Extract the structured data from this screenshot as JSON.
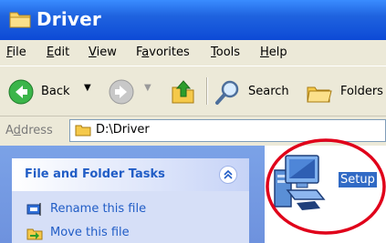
{
  "window": {
    "title": "Driver"
  },
  "menu": [
    {
      "underline": "F",
      "rest": "ile"
    },
    {
      "underline": "E",
      "rest": "dit"
    },
    {
      "underline": "V",
      "rest": "iew"
    },
    {
      "pre": "F",
      "underline": "a",
      "rest": "vorites"
    },
    {
      "underline": "T",
      "rest": "ools"
    },
    {
      "underline": "H",
      "rest": "elp"
    }
  ],
  "toolbar": {
    "back_label": "Back",
    "search_label": "Search",
    "folders_label": "Folders"
  },
  "address": {
    "label_pre": "A",
    "label_underline": "d",
    "label_rest": "dress",
    "path": "D:\\Driver"
  },
  "tasks": {
    "title": "File and Folder Tasks",
    "items": [
      "Rename this file",
      "Move this file"
    ]
  },
  "files": [
    {
      "name": "Setup",
      "icon": "setup-computer-icon",
      "selected": true
    }
  ],
  "colors": {
    "titlebar": "#0d4ad6",
    "taskpane": "#6e92de",
    "selection": "#316ac5",
    "highlight_circle": "#e0001a"
  }
}
